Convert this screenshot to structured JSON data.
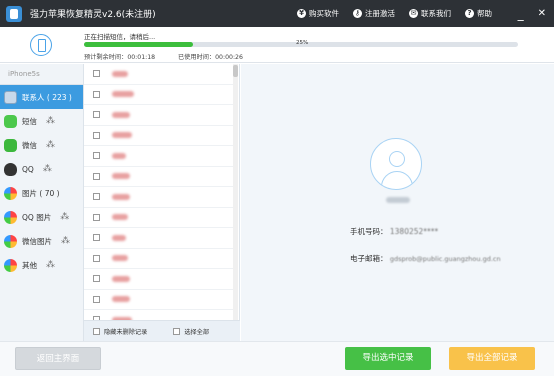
{
  "app": {
    "title": "强力苹果恢复精灵v2.6(未注册)"
  },
  "titlebar": {
    "buy": "购买软件",
    "register": "注册激活",
    "contact": "联系我们",
    "help": "帮助",
    "minimize": "_",
    "close": "✕"
  },
  "scan": {
    "status": "正在扫描短信，请稍后...",
    "progress_percent": 25,
    "progress_label": "25%",
    "time_left_label": "预计剩余时间：",
    "time_left": "00:01:18",
    "time_used_label": "已使用时间：",
    "time_used": "00:00:26"
  },
  "sidebar": {
    "device": "iPhone5s",
    "items": [
      {
        "label": "联系人 ( 223 )",
        "icon": "contacts-icon",
        "color": "#c9d9ea"
      },
      {
        "label": "短信",
        "icon": "sms-icon",
        "color": "#4cc84c"
      },
      {
        "label": "微信",
        "icon": "wechat-icon",
        "color": "#3db83d"
      },
      {
        "label": "QQ",
        "icon": "qq-icon",
        "color": "#333333"
      },
      {
        "label": "图片 ( 70 )",
        "icon": "photos-icon",
        "color": "#f0a030"
      },
      {
        "label": "QQ 图片",
        "icon": "qq-photos-icon",
        "color": "#e86a4a"
      },
      {
        "label": "微信图片",
        "icon": "wechat-photos-icon",
        "color": "#e86a4a"
      },
      {
        "label": "其他",
        "icon": "other-icon",
        "color": "#e86a4a"
      }
    ]
  },
  "list": {
    "hide_deleted": "隐藏未删除记录",
    "select_all": "选择全部"
  },
  "detail": {
    "phone_label": "手机号码：",
    "phone_value": "1380252****",
    "email_label": "电子邮箱：",
    "email_value": "gdsprob@public.guangzhou.gd.cn"
  },
  "buttons": {
    "back": "返回主界面",
    "export_selected": "导出选中记录",
    "export_all": "导出全部记录"
  },
  "colors": {
    "accent": "#3c9be0",
    "progress": "#3cbe3c",
    "export_selected": "#46c046",
    "export_all": "#f9c24a"
  }
}
